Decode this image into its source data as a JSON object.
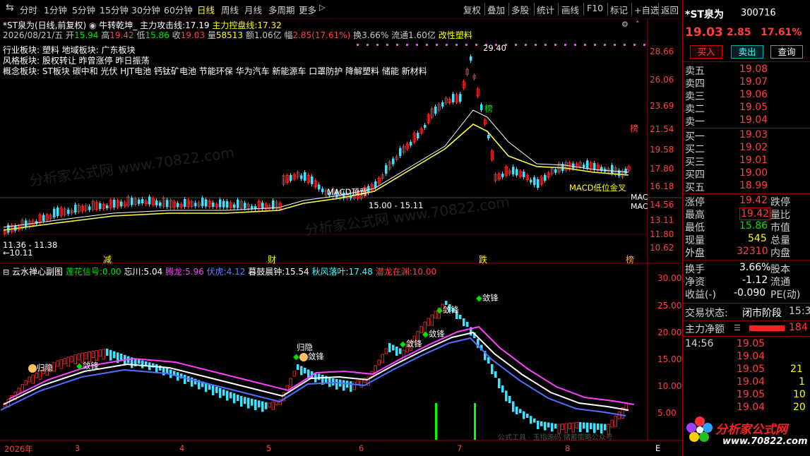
{
  "toolbar": {
    "periods": [
      "分时",
      "1分钟",
      "5分钟",
      "15分钟",
      "30分钟",
      "60分钟",
      "日线",
      "周线",
      "月线",
      "多周期",
      "更多"
    ],
    "active_period": "日线",
    "right": [
      "复权",
      "叠加",
      "多股",
      "统计",
      "画线",
      "F10",
      "标记",
      "+自选",
      "返回"
    ]
  },
  "header": {
    "title": "*ST泉为(日线,前复权)",
    "indicator_name": "牛转乾坤_",
    "attack_label": "主力攻击线:",
    "attack_value": "17.19",
    "control_label": "主力控盘线:",
    "control_value": "17.32",
    "date": "2026/08/21/五",
    "open_label": "开",
    "open": "15.94",
    "high_label": "高",
    "high": "19.42",
    "low_label": "低",
    "low": "15.86",
    "close_label": "收",
    "close": "19.03",
    "vol_label": "量",
    "vol": "58513",
    "amount_label": "额",
    "amount": "1.06亿",
    "range_label": "幅",
    "range": "2.85(17.61%)",
    "turnover_label": "换",
    "turnover": "3.66%",
    "float_label": "流通",
    "float": "1.60亿",
    "concept_tag": "改性塑料"
  },
  "sectors": {
    "line1": "行业板块: 塑料    地域板块: 广东板块",
    "line2": "风格板块: 股权转让 昨曾涨停 昨日振荡",
    "line3": "概念板块: ST板块 碳中和 光伏 HJT电池 钙钛矿电池 节能环保 华为汽车 新能源车 口罩防护 降解塑料 储能 新材料"
  },
  "price_axis": [
    "28.66",
    "26.06",
    "23.69",
    "21.54",
    "19.58",
    "17.80",
    "16.18",
    "14.56",
    "13.11",
    "11.80",
    "10.62"
  ],
  "main_annotations": {
    "peak": "29.40",
    "macd_top": "MACD顶背",
    "range_label": "15.00 - 15.11",
    "bang1": "榜",
    "bang2": "榜",
    "macd_gold": "MACD低位金叉",
    "mac1": "MAC",
    "mac2": "MAC",
    "low_range": "11.36 - 11.38",
    "low_price": "10.11",
    "marker_jian": "减",
    "marker_cai": "财",
    "marker_die": "跌",
    "marker_bang": "榜"
  },
  "sub": {
    "name": "云水禅心副图",
    "lotus_label": "莲花信号:",
    "lotus": "0.00",
    "wangchuan_label": "忘川:",
    "wangchuan": "5.04",
    "tenglong_label": "腾龙:",
    "tenglong": "5.96",
    "fuhu_label": "伏虎:",
    "fuhu": "4.12",
    "mugu_label": "暮鼓晨钟:",
    "mugu": "15.54",
    "qiufeng_label": "秋风落叶:",
    "qiufeng": "17.48",
    "qianlong_label": "潜龙在渊:",
    "qianlong": "10.00",
    "axis": [
      "30.00",
      "25.00",
      "20.00",
      "15.00",
      "10.00",
      "5.00"
    ],
    "signal_jianfeng": "敛锋",
    "signal_guiyin": "归隐",
    "footer_watermark": "公式工具 · 玉指源码 储蓄策略公众号"
  },
  "date_axis": [
    "2026年",
    "3",
    "4",
    "5",
    "6",
    "7",
    "8"
  ],
  "date_axis_e": "E",
  "watermark": "分析家公式网 www.70822.com",
  "rpanel": {
    "name": "*ST泉为",
    "code": "300716",
    "price": "19.03",
    "change": "2.85",
    "pct": "17.61%",
    "buy": "买入",
    "sell": "卖出",
    "query": "查询",
    "asks": [
      [
        "卖五",
        "19.08"
      ],
      [
        "卖四",
        "19.07"
      ],
      [
        "卖三",
        "19.06"
      ],
      [
        "卖二",
        "19.05"
      ],
      [
        "卖一",
        "19.04"
      ]
    ],
    "bids": [
      [
        "买一",
        "19.03"
      ],
      [
        "买二",
        "19.02"
      ],
      [
        "买三",
        "19.01"
      ],
      [
        "买四",
        "19.00"
      ],
      [
        "买五",
        "18.99"
      ]
    ],
    "stats": [
      [
        "涨停",
        "19.42",
        "跌停"
      ],
      [
        "最高",
        "19.42",
        "量比"
      ],
      [
        "最低",
        "15.86",
        "市值"
      ],
      [
        "现量",
        "545",
        "总量"
      ],
      [
        "外盘",
        "32310",
        "内盘"
      ]
    ],
    "stats2": [
      [
        "换手",
        "3.66%",
        "股本"
      ],
      [
        "净资",
        "-1.12",
        "流通"
      ],
      [
        "收益(-)",
        "-0.090",
        "PE(动)"
      ]
    ],
    "status_label": "交易状态:",
    "status": "闭市阶段",
    "status_time": "15:30",
    "flow_label": "主力净额",
    "flow_value": "184",
    "ticks": [
      [
        "14:56",
        "19.05",
        ""
      ],
      [
        "",
        "19.04",
        ""
      ],
      [
        "",
        "19.05",
        "21"
      ],
      [
        "",
        "19.04",
        "1"
      ],
      [
        "",
        "19.05",
        "10"
      ],
      [
        "",
        "19.04",
        "20"
      ]
    ],
    "logo_text": "分析家公式网",
    "logo_url": "www.70822.com"
  }
}
